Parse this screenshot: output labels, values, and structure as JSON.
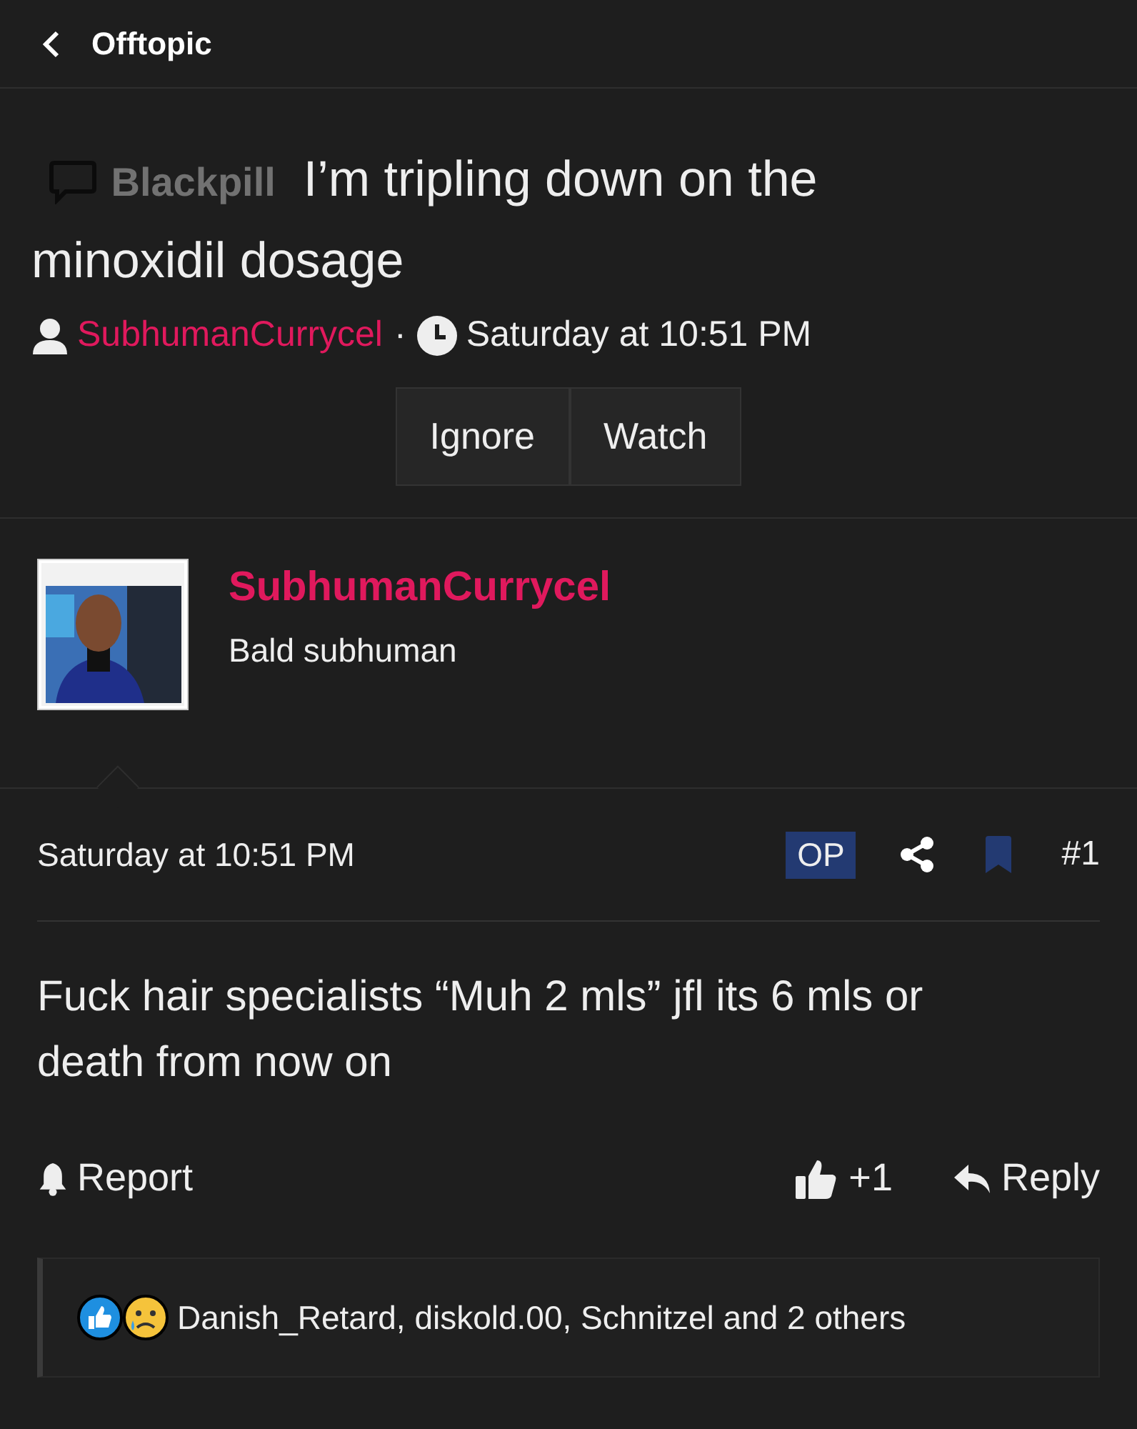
{
  "header": {
    "forum": "Offtopic"
  },
  "thread": {
    "prefix": "Blackpill",
    "title": "I’m tripling down on the minoxidil dosage",
    "author": "SubhumanCurrycel",
    "separator": "·",
    "date": "Saturday at 10:51 PM",
    "buttons": [
      "Ignore",
      "Watch"
    ]
  },
  "post": {
    "author": "SubhumanCurrycel",
    "user_title": "Bald subhuman",
    "date": "Saturday at 10:51 PM",
    "badge": "OP",
    "number": "#1",
    "body": "Fuck hair specialists “Muh 2 mls” jfl its 6 mls or death from now on",
    "actions": {
      "report": "Report",
      "like_count": "+1",
      "reply": "Reply"
    },
    "reactions": "Danish_Retard, diskold.00, Schnitzel and 2 others"
  }
}
